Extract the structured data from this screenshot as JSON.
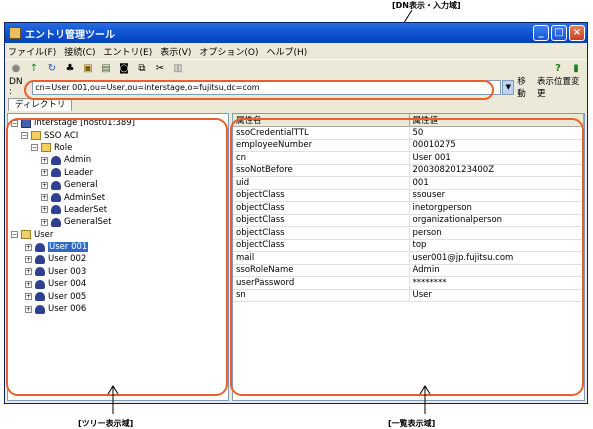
{
  "callouts": {
    "dn": "[DN表示・入力域]",
    "tree": "[ツリー表示域]",
    "list": "[一覧表示域]"
  },
  "window": {
    "title": "エントリ管理ツール",
    "menu": [
      "ファイル(F)",
      "接続(C)",
      "エントリ(E)",
      "表示(V)",
      "オプション(O)",
      "ヘルプ(H)"
    ],
    "toolbar_icons": [
      "connect-icon",
      "up-icon",
      "refresh-icon",
      "find-icon",
      "new-entry-icon",
      "delete-icon",
      "binoculars-icon",
      "copy-icon",
      "cut-icon",
      "paste-icon"
    ],
    "help_icon": "?",
    "dn_label": "DN :",
    "dn_value": "cn=User 001,ou=User,ou=interstage,o=fujitsu,dc=com",
    "move_label": "移動",
    "layout_label": "表示位置変更",
    "tab_label": "ディレクトリ"
  },
  "tree": {
    "root": "interstage [host01:389]",
    "sso_acl": "SSO ACI",
    "role": "Role",
    "roles": [
      "Admin",
      "Leader",
      "General",
      "AdminSet",
      "LeaderSet",
      "GeneralSet"
    ],
    "user_folder": "User",
    "users": [
      "User 001",
      "User 002",
      "User 003",
      "User 004",
      "User 005",
      "User 006"
    ]
  },
  "list": {
    "headers": [
      "属性名",
      "属性値"
    ],
    "rows": [
      [
        "ssoCredentialTTL",
        "50"
      ],
      [
        "employeeNumber",
        "00010275"
      ],
      [
        "cn",
        "User 001"
      ],
      [
        "ssoNotBefore",
        "20030820123400Z"
      ],
      [
        "uid",
        "001"
      ],
      [
        "objectClass",
        "ssouser"
      ],
      [
        "objectClass",
        "inetorgperson"
      ],
      [
        "objectClass",
        "organizationalperson"
      ],
      [
        "objectClass",
        "person"
      ],
      [
        "objectClass",
        "top"
      ],
      [
        "mail",
        "user001@jp.fujitsu.com"
      ],
      [
        "ssoRoleName",
        "Admin"
      ],
      [
        "userPassword",
        "********"
      ],
      [
        "sn",
        "User"
      ]
    ]
  },
  "colors": {
    "highlight": "#e8602c",
    "titlebar": "#0a4fd0",
    "selection": "#316ac5"
  }
}
